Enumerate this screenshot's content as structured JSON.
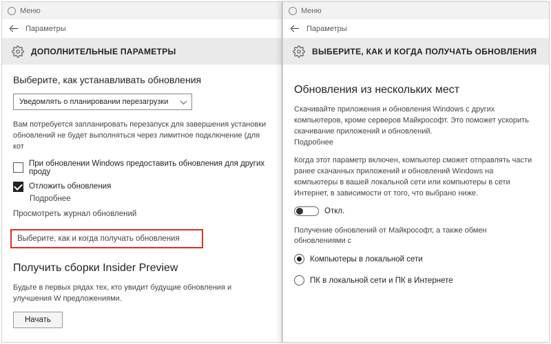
{
  "left": {
    "menu": "Меню",
    "breadcrumb": "Параметры",
    "title": "ДОПОЛНИТЕЛЬНЫЕ ПАРАМЕТРЫ",
    "section1": "Выберите, как устанавливать обновления",
    "select_value": "Уведомлять о планировании перезагрузки",
    "desc1": "Вам потребуется запланировать перезапуск для завершения установки обновлений не будет выполняться через лимитное подключение (для кот",
    "check1": "При обновлении Windows предоставить обновления для других проду",
    "check2": "Отложить обновления",
    "more": "Подробнее",
    "log_link": "Просмотреть журнал обновлений",
    "delivery_link": "Выберите, как и когда получать обновления",
    "insider_h": "Получить сборки Insider Preview",
    "insider_desc": "Будьте в первых рядах тех, кто увидит будущие обновления и улучшения W предложениями.",
    "start_btn": "Начать"
  },
  "right": {
    "menu": "Меню",
    "breadcrumb": "Параметры",
    "title": "ВЫБЕРИТЕ, КАК И КОГДА ПОЛУЧАТЬ ОБНОВЛЕНИЯ",
    "section1": "Обновления из нескольких мест",
    "desc1": "Скачивайте приложения и обновления Windows с других компьютеров, кроме серверов Майкрософт. Это поможет ускорить скачивание приложений и обновлений.",
    "more": "Подробнее",
    "desc2": "Когда этот параметр включен, компьютер сможет отправлять части ранее скачанных приложений и обновлений Windows на компьютеры в вашей локальной сети или компьютеры в сети Интернет, в зависимости от того, что выбрано ниже.",
    "toggle_label": "Откл.",
    "desc3": "Получение обновлений от Майкрософт, а также обмен обновлениями с",
    "radio1": "Компьютеры в локальной сети",
    "radio2": "ПК в локальной сети и ПК в Интернете"
  }
}
